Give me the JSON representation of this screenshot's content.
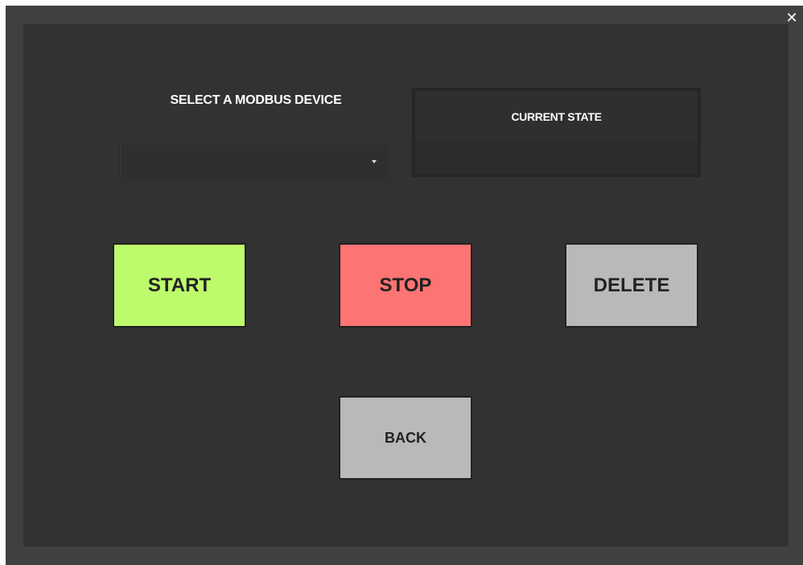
{
  "window": {
    "close_symbol": "✕"
  },
  "device_selector": {
    "label": "SELECT A MODBUS DEVICE",
    "selected_value": "",
    "caret_icon": "chevron-down-icon"
  },
  "state_panel": {
    "header": "CURRENT STATE",
    "value": ""
  },
  "buttons": {
    "start": "START",
    "stop": "STOP",
    "delete": "DELETE",
    "back": "BACK"
  },
  "colors": {
    "start": "#bdfb6c",
    "stop": "#fc7474",
    "neutral": "#b9b9b9",
    "background": "#323232"
  }
}
